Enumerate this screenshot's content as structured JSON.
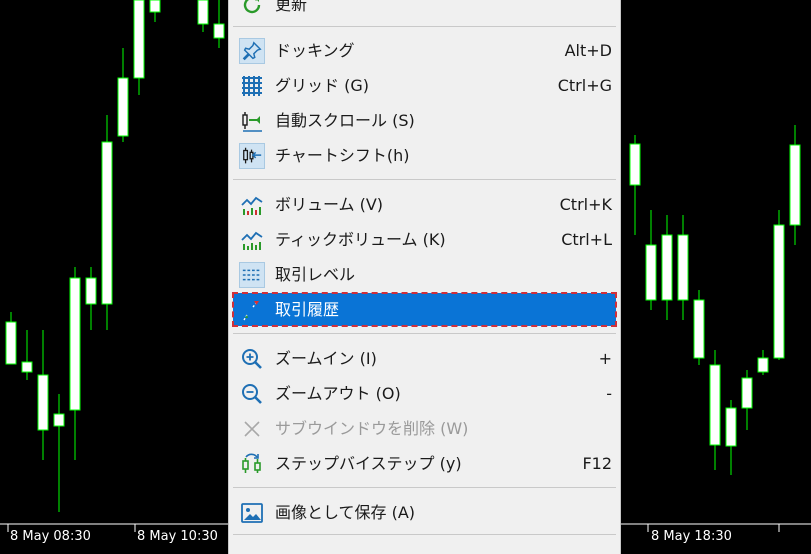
{
  "colors": {
    "bull": "#00ff00",
    "body": "#ffffff",
    "bg": "#000000",
    "menu_bg": "#f0f0f0",
    "selected": "#0a74d6",
    "accent_icon": "#1e6fb4"
  },
  "time_axis": [
    "8 May 08:30",
    "8 May 10:30",
    "8 May 18:30"
  ],
  "menu": {
    "items": [
      {
        "label": "更新",
        "shortcut": "",
        "icon": "refresh-icon"
      },
      {
        "label": "ドッキング",
        "shortcut": "Alt+D",
        "icon": "pin-icon"
      },
      {
        "label": "グリッド (G)",
        "shortcut": "Ctrl+G",
        "icon": "grid-icon"
      },
      {
        "label": "自動スクロール (S)",
        "shortcut": "",
        "icon": "autoscroll-icon"
      },
      {
        "label": "チャートシフト(h)",
        "shortcut": "",
        "icon": "chart-shift-icon"
      },
      {
        "label": "ボリューム (V)",
        "shortcut": "Ctrl+K",
        "icon": "volume-icon"
      },
      {
        "label": "ティックボリューム (K)",
        "shortcut": "Ctrl+L",
        "icon": "tick-volume-icon"
      },
      {
        "label": "取引レベル",
        "shortcut": "",
        "icon": "trade-levels-icon"
      },
      {
        "label": "取引履歴",
        "shortcut": "",
        "icon": "trade-history-icon"
      },
      {
        "label": "ズームイン (I)",
        "shortcut": "+",
        "icon": "zoom-in-icon"
      },
      {
        "label": "ズームアウト (O)",
        "shortcut": "-",
        "icon": "zoom-out-icon"
      },
      {
        "label": "サブウインドウを削除 (W)",
        "shortcut": "",
        "icon": "close-icon"
      },
      {
        "label": "ステップバイステップ (y)",
        "shortcut": "F12",
        "icon": "step-icon"
      },
      {
        "label": "画像として保存 (A)",
        "shortcut": "",
        "icon": "image-icon"
      }
    ],
    "checked": [
      "ドッキング",
      "チャートシフト(h)",
      "取引レベル"
    ],
    "selected": "取引履歴",
    "disabled": [
      "サブウインドウを削除 (W)"
    ]
  }
}
